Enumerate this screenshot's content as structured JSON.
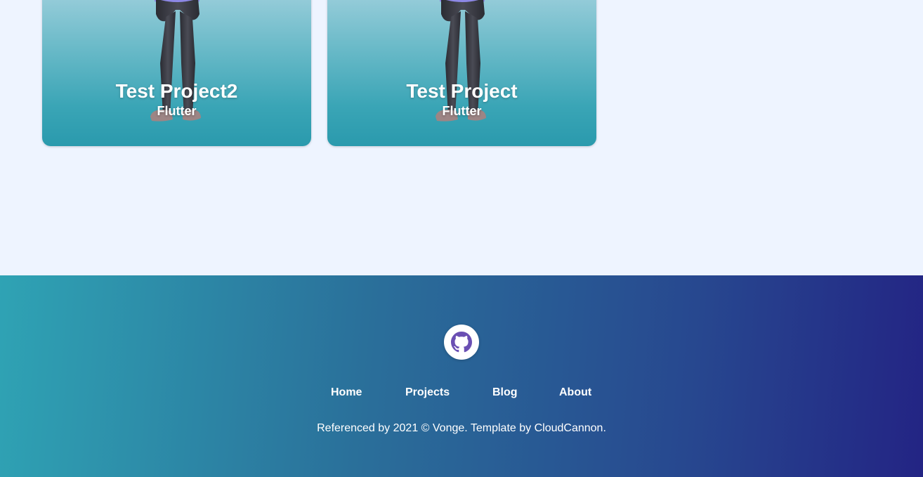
{
  "projects": [
    {
      "title": "Test Project2",
      "tag": "Flutter"
    },
    {
      "title": "Test Project",
      "tag": "Flutter"
    }
  ],
  "footer": {
    "social_icon": "github-icon",
    "nav": [
      "Home",
      "Projects",
      "Blog",
      "About"
    ],
    "copyright": "Referenced by 2021 © Vonge. Template by CloudCannon."
  },
  "colors": {
    "page_bg": "#eef4ff",
    "card_gradient_top": "#9fd0dd",
    "card_gradient_bottom": "#2a9aad",
    "footer_gradient_start": "#2fa3b4",
    "footer_gradient_end": "#232484",
    "github_icon": "#6a4fb3"
  }
}
